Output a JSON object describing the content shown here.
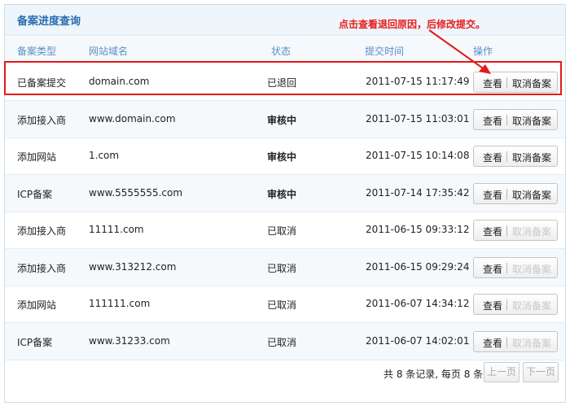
{
  "panel": {
    "title": "备案进度查询",
    "annotation": "点击查看退回原因，后修改提交。"
  },
  "columns": {
    "type": "备案类型",
    "domain": "网站域名",
    "status": "状态",
    "time": "提交时间",
    "action": "操作"
  },
  "actions": {
    "view": "查看",
    "cancel": "取消备案"
  },
  "rows": [
    {
      "type": "已备案提交",
      "domain": "domain.com",
      "status": "已退回",
      "time": "2011-07-15 11:17:49"
    },
    {
      "type": "添加接入商",
      "domain": "www.domain.com",
      "status": "审核中",
      "time": "2011-07-15 11:03:01"
    },
    {
      "type": "添加网站",
      "domain": "1.com",
      "status": "审核中",
      "time": "2011-07-15 10:14:08"
    },
    {
      "type": "ICP备案",
      "domain": "www.5555555.com",
      "status": "审核中",
      "time": "2011-07-14 17:35:42"
    },
    {
      "type": "添加接入商",
      "domain": "11111.com",
      "status": "已取消",
      "time": "2011-06-15 09:33:12"
    },
    {
      "type": "添加接入商",
      "domain": "www.313212.com",
      "status": "已取消",
      "time": "2011-06-15 09:29:24"
    },
    {
      "type": "添加网站",
      "domain": "111111.com",
      "status": "已取消",
      "time": "2011-06-07 14:34:12"
    },
    {
      "type": "ICP备案",
      "domain": "www.31233.com",
      "status": "已取消",
      "time": "2011-06-07 14:02:01"
    }
  ],
  "footer": {
    "summary": "共 8 条记录, 每页  8 条",
    "prev": "上一页",
    "next": "下一页"
  },
  "colors": {
    "accent": "#2b6cb0",
    "header_text": "#5a8fc2",
    "under_review": "#e10c0c",
    "cancelled": "#c8c8c8",
    "highlight": "#e21a1a"
  }
}
